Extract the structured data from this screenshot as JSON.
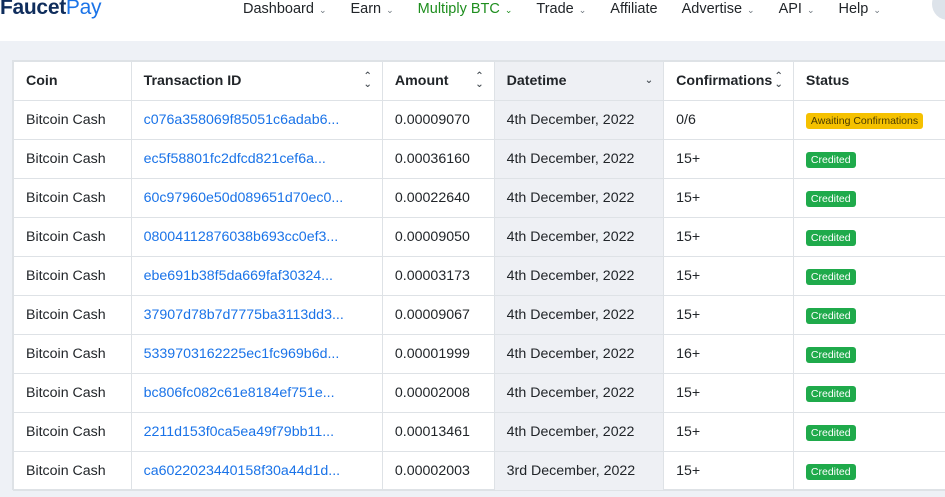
{
  "brand": {
    "part1": "Faucet",
    "part2": "Pay"
  },
  "nav": [
    {
      "label": "Dashboard",
      "dropdown": true,
      "active": false
    },
    {
      "label": "Earn",
      "dropdown": true,
      "active": false
    },
    {
      "label": "Multiply BTC",
      "dropdown": true,
      "active": true
    },
    {
      "label": "Trade",
      "dropdown": true,
      "active": false
    },
    {
      "label": "Affiliate",
      "dropdown": false,
      "active": false
    },
    {
      "label": "Advertise",
      "dropdown": true,
      "active": false
    },
    {
      "label": "API",
      "dropdown": true,
      "active": false
    },
    {
      "label": "Help",
      "dropdown": true,
      "active": false
    }
  ],
  "table": {
    "columns": [
      "Coin",
      "Transaction ID",
      "Amount",
      "Datetime",
      "Confirmations",
      "Status"
    ],
    "rows": [
      {
        "coin": "Bitcoin Cash",
        "txid": "c076a358069f85051c6adab6...",
        "amount": "0.00009070",
        "datetime": "4th December, 2022",
        "confirmations": "0/6",
        "status": "Awaiting Confirmations",
        "status_type": "awaiting"
      },
      {
        "coin": "Bitcoin Cash",
        "txid": "ec5f58801fc2dfcd821cef6a...",
        "amount": "0.00036160",
        "datetime": "4th December, 2022",
        "confirmations": "15+",
        "status": "Credited",
        "status_type": "credited"
      },
      {
        "coin": "Bitcoin Cash",
        "txid": "60c97960e50d089651d70ec0...",
        "amount": "0.00022640",
        "datetime": "4th December, 2022",
        "confirmations": "15+",
        "status": "Credited",
        "status_type": "credited"
      },
      {
        "coin": "Bitcoin Cash",
        "txid": "08004112876038b693cc0ef3...",
        "amount": "0.00009050",
        "datetime": "4th December, 2022",
        "confirmations": "15+",
        "status": "Credited",
        "status_type": "credited"
      },
      {
        "coin": "Bitcoin Cash",
        "txid": "ebe691b38f5da669faf30324...",
        "amount": "0.00003173",
        "datetime": "4th December, 2022",
        "confirmations": "15+",
        "status": "Credited",
        "status_type": "credited"
      },
      {
        "coin": "Bitcoin Cash",
        "txid": "37907d78b7d7775ba3113dd3...",
        "amount": "0.00009067",
        "datetime": "4th December, 2022",
        "confirmations": "15+",
        "status": "Credited",
        "status_type": "credited"
      },
      {
        "coin": "Bitcoin Cash",
        "txid": "5339703162225ec1fc969b6d...",
        "amount": "0.00001999",
        "datetime": "4th December, 2022",
        "confirmations": "16+",
        "status": "Credited",
        "status_type": "credited"
      },
      {
        "coin": "Bitcoin Cash",
        "txid": "bc806fc082c61e8184ef751e...",
        "amount": "0.00002008",
        "datetime": "4th December, 2022",
        "confirmations": "15+",
        "status": "Credited",
        "status_type": "credited"
      },
      {
        "coin": "Bitcoin Cash",
        "txid": "2211d153f0ca5ea49f79bb11...",
        "amount": "0.00013461",
        "datetime": "4th December, 2022",
        "confirmations": "15+",
        "status": "Credited",
        "status_type": "credited"
      },
      {
        "coin": "Bitcoin Cash",
        "txid": "ca6022023440158f30a44d1d...",
        "amount": "0.00002003",
        "datetime": "3rd December, 2022",
        "confirmations": "15+",
        "status": "Credited",
        "status_type": "credited"
      }
    ]
  },
  "colors": {
    "link": "#1a73e8",
    "active_nav": "#1e8e1e",
    "credited": "#1faa4b",
    "awaiting": "#f5c100"
  }
}
